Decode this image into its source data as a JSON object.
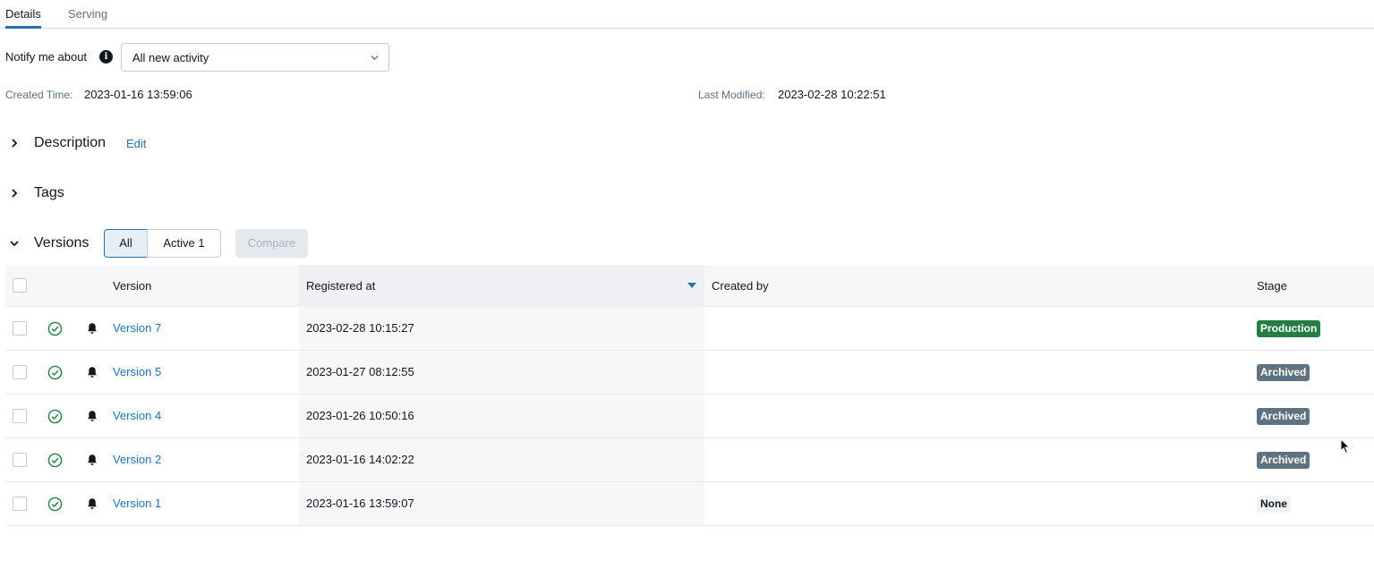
{
  "tabs": [
    {
      "label": "Details",
      "active": true
    },
    {
      "label": "Serving",
      "active": false
    }
  ],
  "notify": {
    "label": "Notify me about",
    "selected": "All new activity"
  },
  "meta": {
    "created_label": "Created Time:",
    "created_value": "2023-01-16 13:59:06",
    "modified_label": "Last Modified:",
    "modified_value": "2023-02-28 10:22:51"
  },
  "sections": {
    "description": "Description",
    "edit_label": "Edit",
    "tags": "Tags",
    "versions": "Versions"
  },
  "filters": {
    "all_label": "All",
    "active_label": "Active 1",
    "compare_label": "Compare"
  },
  "table": {
    "headers": {
      "version": "Version",
      "registered": "Registered at",
      "created_by": "Created by",
      "stage": "Stage"
    },
    "rows": [
      {
        "version": "Version 7",
        "registered": "2023-02-28 10:15:27",
        "created_by": "",
        "stage": "Production",
        "stage_kind": "production"
      },
      {
        "version": "Version 5",
        "registered": "2023-01-27 08:12:55",
        "created_by": "",
        "stage": "Archived",
        "stage_kind": "archived"
      },
      {
        "version": "Version 4",
        "registered": "2023-01-26 10:50:16",
        "created_by": "",
        "stage": "Archived",
        "stage_kind": "archived"
      },
      {
        "version": "Version 2",
        "registered": "2023-01-16 14:02:22",
        "created_by": "",
        "stage": "Archived",
        "stage_kind": "archived"
      },
      {
        "version": "Version 1",
        "registered": "2023-01-16 13:59:07",
        "created_by": "",
        "stage": "None",
        "stage_kind": "none"
      }
    ]
  },
  "colors": {
    "link": "#2272b4",
    "production": "#277c43",
    "archived": "#5f7281",
    "success": "#277c43"
  },
  "icons": [
    "info-icon",
    "chevron-down-icon",
    "chevron-right-icon",
    "check-circle-icon",
    "bell-icon",
    "sort-desc-icon",
    "mouse-cursor-icon"
  ]
}
